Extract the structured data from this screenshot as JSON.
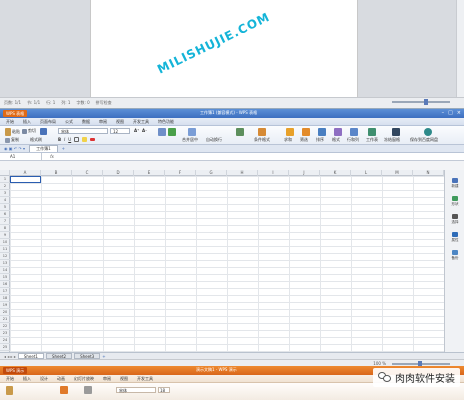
{
  "writer": {
    "status_items": [
      "页数: 1/1",
      "节: 1/1",
      "行: 1",
      "列: 1",
      "字数: 0",
      "拼写检查"
    ]
  },
  "spreadsheet": {
    "app_button": "WPS 表格",
    "window_title": "工作簿1 (兼容模式) - WPS 表格",
    "menu": [
      "开始",
      "插入",
      "页面布局",
      "公式",
      "数据",
      "审阅",
      "视图",
      "开发工具",
      "特色功能"
    ],
    "ribbon": {
      "paste": "粘贴",
      "cut": "剪切",
      "copy": "复制",
      "format_painter": "格式刷",
      "font_name": "宋体",
      "font_size": "12",
      "merge_center": "合并居中",
      "auto_wrap": "自动换行",
      "conditional_format": "条件格式",
      "table_style": "表格样式",
      "sum": "求和",
      "filter": "筛选",
      "sort": "排序",
      "format": "格式",
      "rows_cols": "行和列",
      "worksheet": "工作表",
      "freeze": "冻结窗格",
      "find_replace": "查找",
      "save_cloud": "保存到百度网盘"
    },
    "doc_tab": "工作簿1",
    "name_box": "A1",
    "fx_label": "fx",
    "columns": [
      "A",
      "B",
      "C",
      "D",
      "E",
      "F",
      "G",
      "H",
      "I",
      "J",
      "K",
      "L",
      "M",
      "N"
    ],
    "rows": [
      "1",
      "2",
      "3",
      "4",
      "5",
      "6",
      "7",
      "8",
      "9",
      "10",
      "11",
      "12",
      "13",
      "14",
      "15",
      "16",
      "17",
      "18",
      "19",
      "20",
      "21",
      "22",
      "23",
      "24",
      "25"
    ],
    "sheets": [
      "Sheet1",
      "Sheet2",
      "Sheet3"
    ],
    "zoom_text": "100 %",
    "side_panel": [
      "新建",
      "形状",
      "选择",
      "属性",
      "备份"
    ]
  },
  "watermark": "MILISHUJIE.COM",
  "presentation": {
    "app_button": "WPS 演示",
    "window_title": "演示文稿1 - WPS 演示",
    "menu": [
      "开始",
      "插入",
      "设计",
      "动画",
      "幻灯片放映",
      "审阅",
      "视图",
      "开发工具"
    ],
    "font_name": "宋体",
    "font_size": "18"
  },
  "wechat_label": "肉肉软件安装",
  "colors": {
    "spreadsheet_title": "#3d6fc0",
    "presentation_title": "#d9661b",
    "watermark": "#14b4d8",
    "app_button_orange": "#e06a16"
  }
}
